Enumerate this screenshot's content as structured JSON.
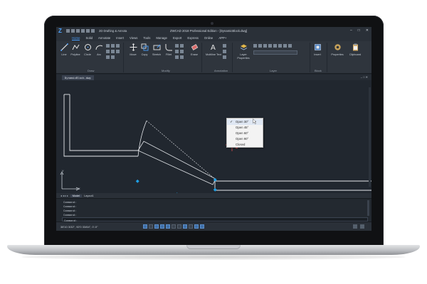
{
  "app": {
    "window_title": "ZWCAD 2018 Professional Edition - [DynamicBlock.dwg]",
    "workspace": "2D Drafting & Annota",
    "win_controls": [
      "–",
      "□",
      "✕"
    ],
    "logo_icon": "zwcad-logo-icon"
  },
  "ribbon_tabs": [
    "Home",
    "Solid",
    "Annotate",
    "Insert",
    "Views",
    "Tools",
    "Manage",
    "Export",
    "Express",
    "Online",
    "APP+"
  ],
  "ribbon": {
    "draw_tools": [
      "Line",
      "Polyline",
      "Circle",
      "Arc"
    ],
    "modify_tools": [
      "Move",
      "Copy",
      "Stretch",
      "Fillet"
    ],
    "erase": "Erase",
    "multiline_text": "Multiline Text",
    "layer_properties": "Layer Properties",
    "insert": "Insert",
    "properties": "Properties",
    "clipboard": "Clipboard",
    "panel_labels": {
      "draw": "Draw",
      "modify": "Modify",
      "annotation": "Annotation",
      "layer": "Layer",
      "block": "Block"
    }
  },
  "document": {
    "tab": "DynamicBlock.dwg",
    "controls": "– □ ✕"
  },
  "context_menu": {
    "items": [
      "Open 30°",
      "Open 45°",
      "Open 60°",
      "Open 90°",
      "Closed"
    ],
    "checked_index": 0,
    "check_mark": "✓"
  },
  "axis": {
    "y": "Y",
    "x": "X"
  },
  "layout_tabs": {
    "nav": "◂ ◂ ▸ ▸",
    "model": "Model",
    "layout": "Layout1"
  },
  "command": {
    "history": [
      "Command:",
      "Command:",
      "Command:",
      "Command:"
    ],
    "input_prefix": "Command:"
  },
  "status": {
    "coords": "38'10 3/32\", 92'0 33/64\", 0'-0\""
  },
  "colors": {
    "accent": "#4aa0ff",
    "grip": "#1ea0e6",
    "canvas": "#21272f"
  }
}
